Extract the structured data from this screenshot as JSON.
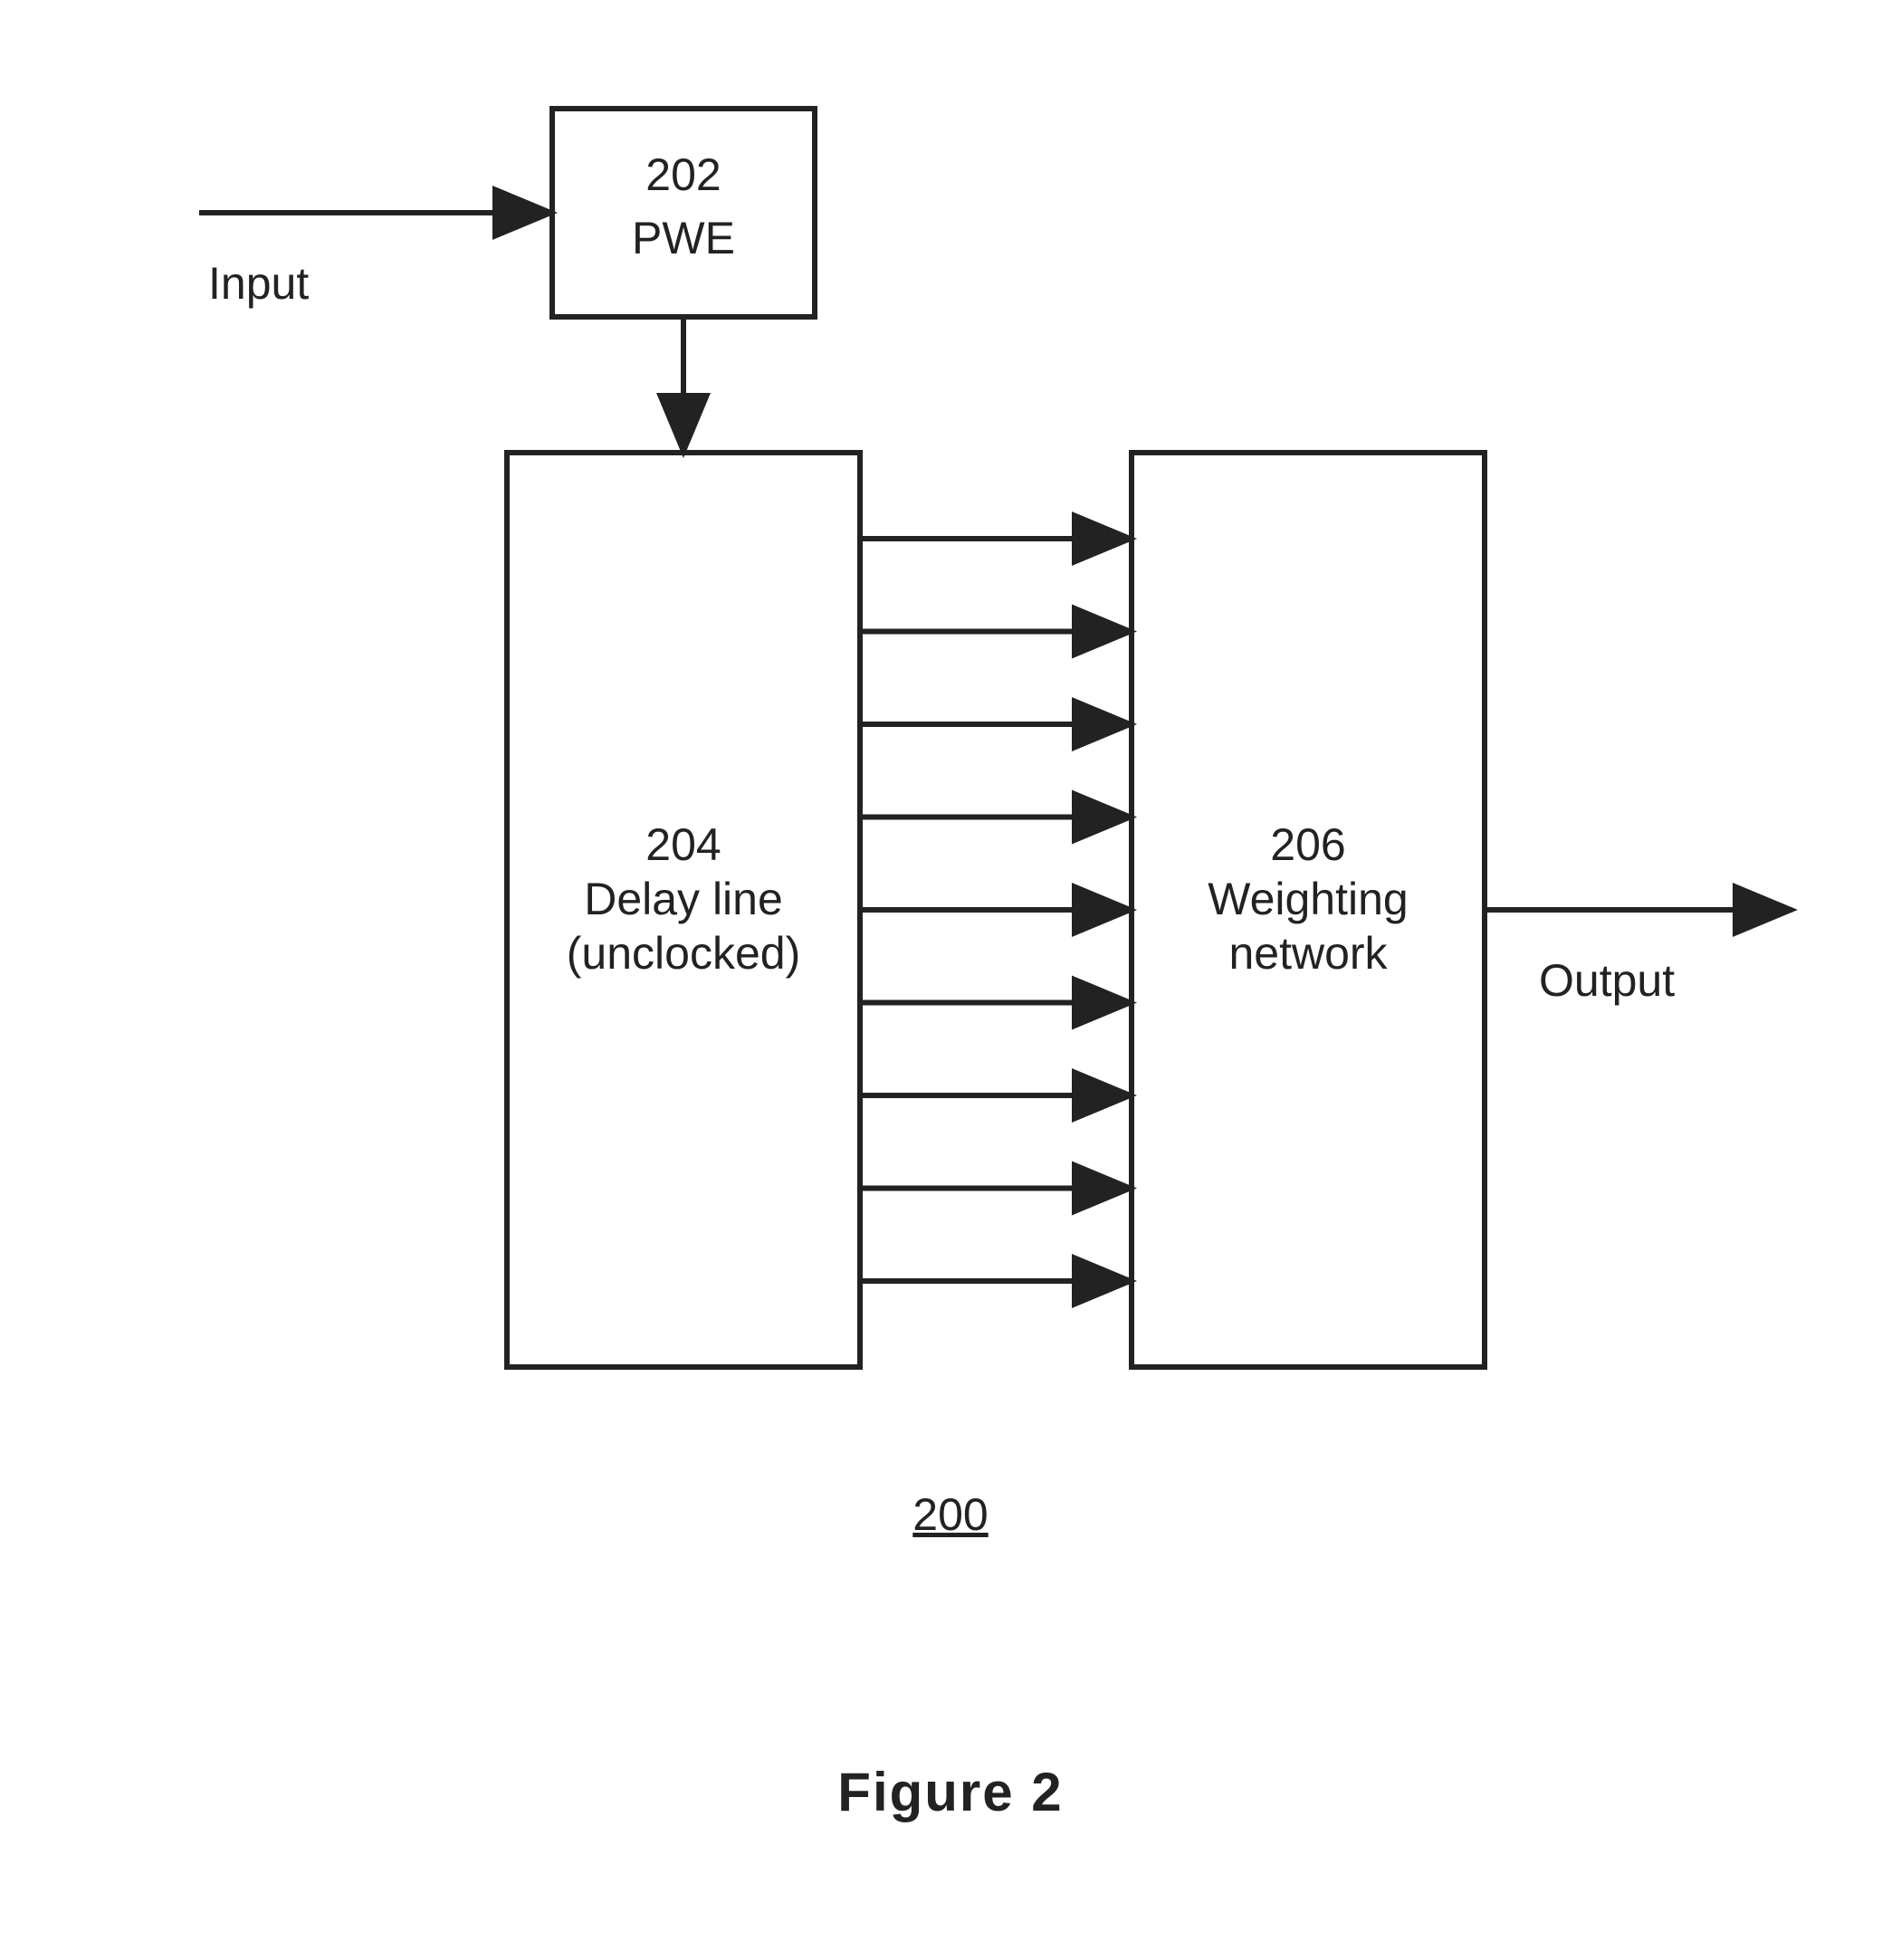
{
  "diagram": {
    "input_label": "Input",
    "output_label": "Output",
    "pwe_block": {
      "number": "202",
      "name": "PWE"
    },
    "delay_line_block": {
      "number": "204",
      "line1": "Delay line",
      "line2": "(unclocked)"
    },
    "weighting_block": {
      "number": "206",
      "line1": "Weighting",
      "line2": "network"
    },
    "circuit_ref": "200",
    "figure_caption": "Figure 2",
    "tap_arrow_count": 9
  }
}
